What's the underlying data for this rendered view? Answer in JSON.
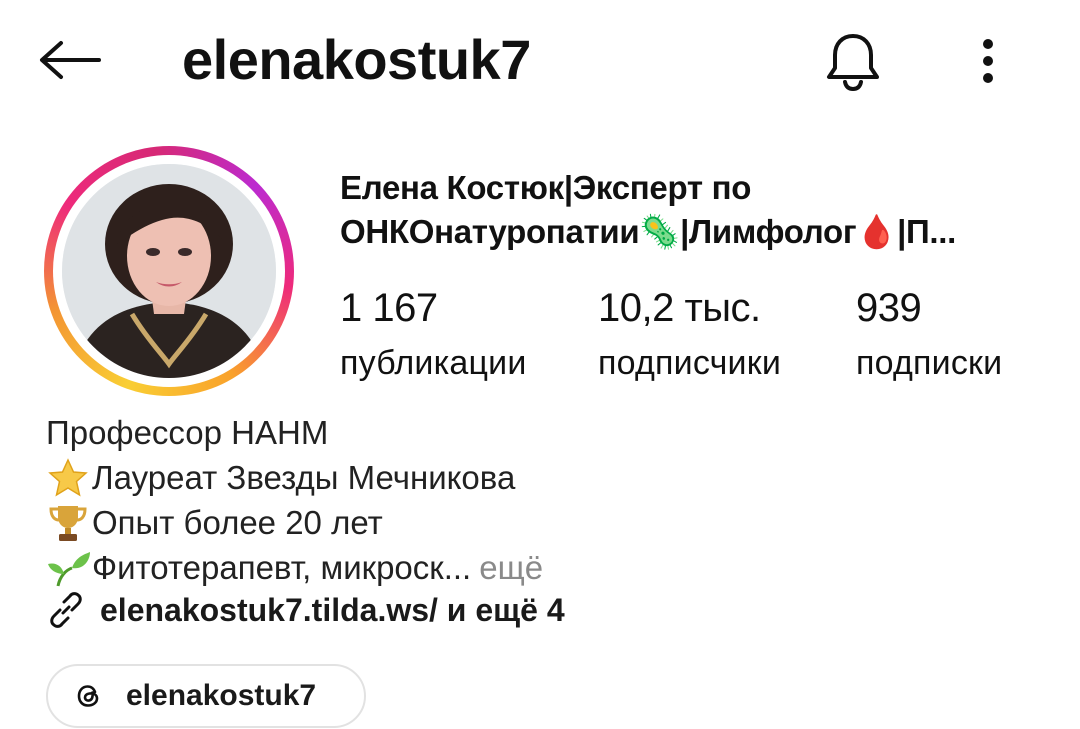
{
  "header": {
    "username": "elenakostuk7",
    "back_icon": "arrow-left-icon",
    "bell_icon": "bell-icon",
    "more_icon": "more-vertical-icon"
  },
  "profile": {
    "full_name": "Елена Костюк|Эксперт по ОНКОнатуропатии🦠|Лимфолог🩸|П...",
    "stats": [
      {
        "value": "1 167",
        "label": "публикации"
      },
      {
        "value": "10,2 тыс.",
        "label": "подписчики"
      },
      {
        "value": "939",
        "label": "подписки"
      }
    ],
    "story_ring_colors": [
      "#f9ce34",
      "#ee2a7b",
      "#bc2bd0"
    ]
  },
  "bio": {
    "lines": [
      {
        "emoji": "",
        "text": "Профессор НАНМ"
      },
      {
        "emoji": "star-icon",
        "text": "Лауреат Звезды Мечникова"
      },
      {
        "emoji": "trophy-icon",
        "text": "Опыт более 20 лет"
      },
      {
        "emoji": "seedling-icon",
        "text": "Фитотерапевт, микроск..."
      }
    ],
    "more_label": "ещё",
    "link_text": "elenakostuk7.tilda.ws/ и ещё 4"
  },
  "threads": {
    "label": "elenakostuk7",
    "icon": "threads-icon"
  }
}
